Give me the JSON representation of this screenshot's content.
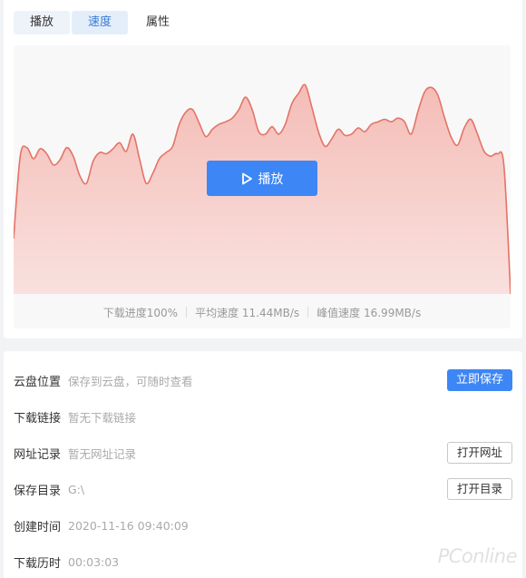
{
  "tabs": [
    {
      "label": "播放"
    },
    {
      "label": "速度"
    },
    {
      "label": "属性"
    }
  ],
  "active_tab": "速度",
  "play_button": {
    "label": "播放"
  },
  "stats": {
    "progress": "下载进度100%",
    "avg_speed": "平均速度 11.44MB/s",
    "peak_speed": "峰值速度 16.99MB/s"
  },
  "chart_data": {
    "type": "area",
    "color_line": "#e57366",
    "color_fill": "#f6c6c2",
    "values": [
      4.5,
      11.2,
      11.9,
      11.0,
      11.8,
      11.4,
      10.5,
      10.9,
      11.9,
      11.2,
      9.6,
      9.0,
      10.8,
      11.5,
      11.4,
      11.8,
      12.3,
      11.6,
      13.0,
      11.0,
      9.0,
      9.8,
      11.0,
      11.5,
      12.0,
      13.8,
      14.8,
      15.0,
      13.9,
      12.8,
      13.4,
      13.8,
      14.0,
      14.3,
      15.0,
      16.0,
      15.0,
      13.2,
      13.0,
      13.6,
      13.0,
      13.8,
      15.5,
      16.3,
      17.0,
      15.2,
      13.2,
      12.0,
      12.6,
      13.4,
      12.9,
      13.0,
      13.5,
      13.2,
      13.8,
      14.0,
      14.2,
      14.0,
      14.3,
      14.0,
      13.0,
      14.8,
      16.4,
      16.8,
      16.2,
      14.4,
      12.8,
      12.1,
      13.5,
      14.2,
      13.0,
      11.6,
      11.2,
      11.4,
      10.4,
      0.0
    ],
    "ylim": [
      0,
      18
    ]
  },
  "info": {
    "rows": [
      {
        "label": "云盘位置",
        "value": "保存到云盘，可随时查看",
        "button": "立即保存"
      },
      {
        "label": "下载链接",
        "value": "暂无下载链接"
      },
      {
        "label": "网址记录",
        "value": "暂无网址记录",
        "button": "打开网址"
      },
      {
        "label": "保存目录",
        "value": "G:\\",
        "button": "打开目录"
      },
      {
        "label": "创建时间",
        "value": "2020-11-16 09:40:09"
      },
      {
        "label": "下载历时",
        "value": "00:03:03"
      }
    ]
  },
  "watermark": {
    "text": "PConline"
  }
}
